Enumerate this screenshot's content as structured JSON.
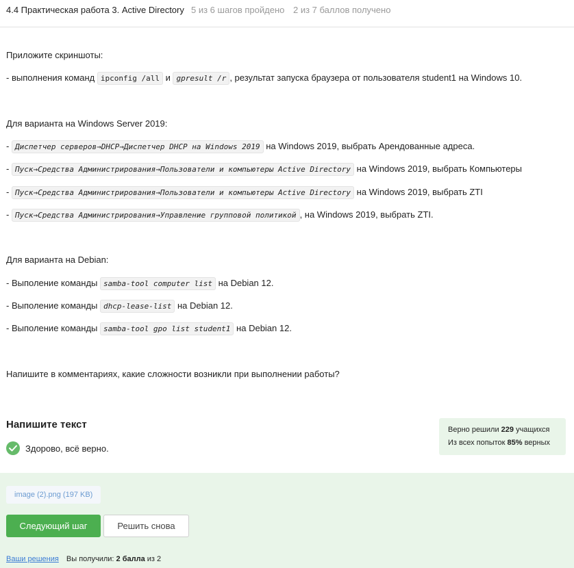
{
  "header": {
    "title": "4.4 Практическая работа 3. Active Directory",
    "steps": "5 из 6 шагов пройдено",
    "points": "2 из 7 баллов  получено"
  },
  "task": {
    "attach_prompt": "Приложите скриншоты:",
    "line1": {
      "prefix": "- выполнения команд ",
      "code1": "ipconfig /all",
      "mid": " и ",
      "code2": "gpresult /r",
      "suffix": ", результат запуска браузера от пользователя student1 на Windows 10."
    },
    "windows_heading": "Для варианта на Windows Server 2019:",
    "windows_items": [
      {
        "prefix": "- ",
        "code": "Диспетчер серверов→DHCP→Диспетчер DHCP на Windows 2019",
        "suffix": " на Windows 2019, выбрать Арендованные адреса."
      },
      {
        "prefix": "- ",
        "code": "Пуск→Средства Администрирования→Пользователи и компьютеры Active Directory",
        "suffix": " на Windows 2019, выбрать Компьютеры"
      },
      {
        "prefix": "- ",
        "code": "Пуск→Средства Администрирования→Пользователи и компьютеры Active Directory",
        "suffix": " на Windows 2019, выбрать ZTI"
      },
      {
        "prefix": "- ",
        "code": "Пуск→Средства Администрирования→Управление групповой политикой",
        "suffix": ", на Windows 2019, выбрать ZTI."
      }
    ],
    "debian_heading": "Для варианта на Debian:",
    "debian_items": [
      {
        "prefix": "- Выполение команды ",
        "code": "samba-tool computer list",
        "suffix": " на Debian 12."
      },
      {
        "prefix": "- Выполение команды ",
        "code": "dhcp-lease-list",
        "suffix": " на Debian 12."
      },
      {
        "prefix": "- Выполение команды ",
        "code": "samba-tool gpo list student1",
        "suffix": " на Debian 12."
      }
    ],
    "comment_prompt": "Напишите в комментариях, какие сложности возникли при выполнении работы?"
  },
  "answer": {
    "heading": "Напишите текст",
    "text": "Здорово, всё верно."
  },
  "stats": {
    "solved_prefix": "Верно решили ",
    "solved_count": "229",
    "solved_suffix": " учащихся",
    "attempts_prefix": "Из всех попыток ",
    "attempts_percent": "85%",
    "attempts_suffix": " верных"
  },
  "feedback": {
    "file_label": "image (2).png (197 KB)",
    "next_button": "Следующий шаг",
    "retry_button": "Решить снова",
    "solutions_link": "Ваши решения",
    "score_prefix": "Вы получили: ",
    "score_value": "2 балла",
    "score_suffix": " из 2"
  },
  "colors": {
    "accent_green": "#4caf50",
    "feedback_bg": "#e9f5e9",
    "link_blue": "#3a7bd5"
  }
}
